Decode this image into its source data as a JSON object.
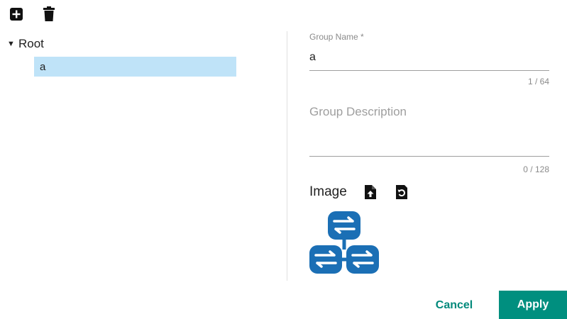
{
  "toolbar": {
    "add_icon": "plus-square-icon",
    "delete_icon": "trash-icon"
  },
  "tree": {
    "root_label": "Root",
    "caret": "▼",
    "children": [
      {
        "label": "a",
        "selected": true
      }
    ]
  },
  "form": {
    "group_name": {
      "label": "Group Name *",
      "value": "a",
      "counter": "1 / 64"
    },
    "group_description": {
      "placeholder": "Group Description",
      "value": "",
      "counter": "0 / 128"
    },
    "image": {
      "label": "Image",
      "upload_icon": "file-upload-icon",
      "reset_icon": "reset-icon",
      "preview_icon": "network-group-icon"
    }
  },
  "buttons": {
    "cancel": "Cancel",
    "apply": "Apply"
  },
  "colors": {
    "accent": "#008f7f",
    "selection": "#bfe3f8",
    "icon_blue": "#1b6fb5"
  }
}
